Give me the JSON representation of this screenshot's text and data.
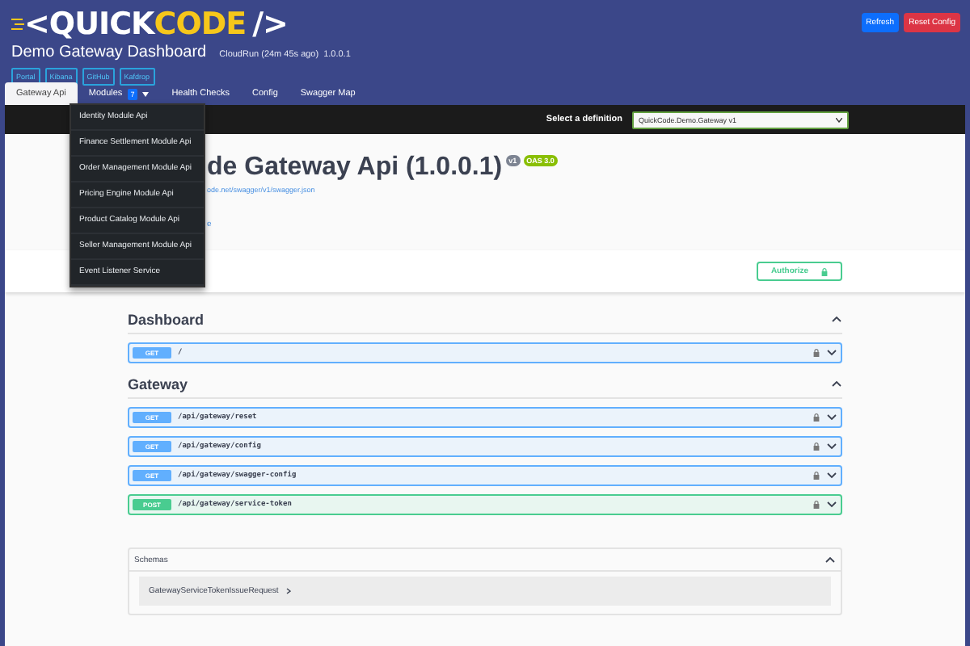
{
  "header": {
    "logo": {
      "prefix": "<",
      "main": "QUICK",
      "accent": "CODE",
      "suffix": "/>"
    },
    "title": "Demo Gateway Dashboard",
    "environment": "CloudRun (24m 45s ago)",
    "version": "1.0.0.1",
    "links": [
      "Portal",
      "Kibana",
      "GitHub",
      "Kafdrop"
    ],
    "actions": [
      {
        "label": "Refresh",
        "kind": "primary"
      },
      {
        "label": "Reset Config",
        "kind": "danger"
      }
    ]
  },
  "tabs": [
    {
      "label": "Gateway Api",
      "selected": true
    },
    {
      "label": "Modules",
      "selected": false,
      "badge": "7",
      "expanded": true
    },
    {
      "label": "Health Checks",
      "selected": false
    },
    {
      "label": "Config",
      "selected": false
    },
    {
      "label": "Swagger Map",
      "selected": false
    }
  ],
  "modules_menu": [
    "Identity Module Api",
    "Finance Settlement Module Api",
    "Order Management Module Api",
    "Pricing Engine Module Api",
    "Product Catalog Module Api",
    "Seller Management Module Api",
    "Event Listener Service"
  ],
  "topbar": {
    "label": "Select a definition",
    "definition": "QuickCode.Demo.Gateway v1"
  },
  "info": {
    "title": "de Gateway Api (1.0.0.1)",
    "version_badge": "v1",
    "oas_badge": "OAS 3.0",
    "spec_link": "ode.net/swagger/v1/swagger.json",
    "link_fragment": "e"
  },
  "authorize": "Authorize",
  "tags": [
    {
      "name": "Dashboard",
      "expanded": true,
      "operations": [
        {
          "method": "GET",
          "path": "/"
        }
      ]
    },
    {
      "name": "Gateway",
      "expanded": true,
      "operations": [
        {
          "method": "GET",
          "path": "/api/gateway/reset"
        },
        {
          "method": "GET",
          "path": "/api/gateway/config"
        },
        {
          "method": "GET",
          "path": "/api/gateway/swagger-config"
        },
        {
          "method": "POST",
          "path": "/api/gateway/service-token"
        }
      ]
    }
  ],
  "schemas": {
    "title": "Schemas",
    "expanded": true,
    "items": [
      "GatewayServiceTokenIssueRequest"
    ]
  }
}
